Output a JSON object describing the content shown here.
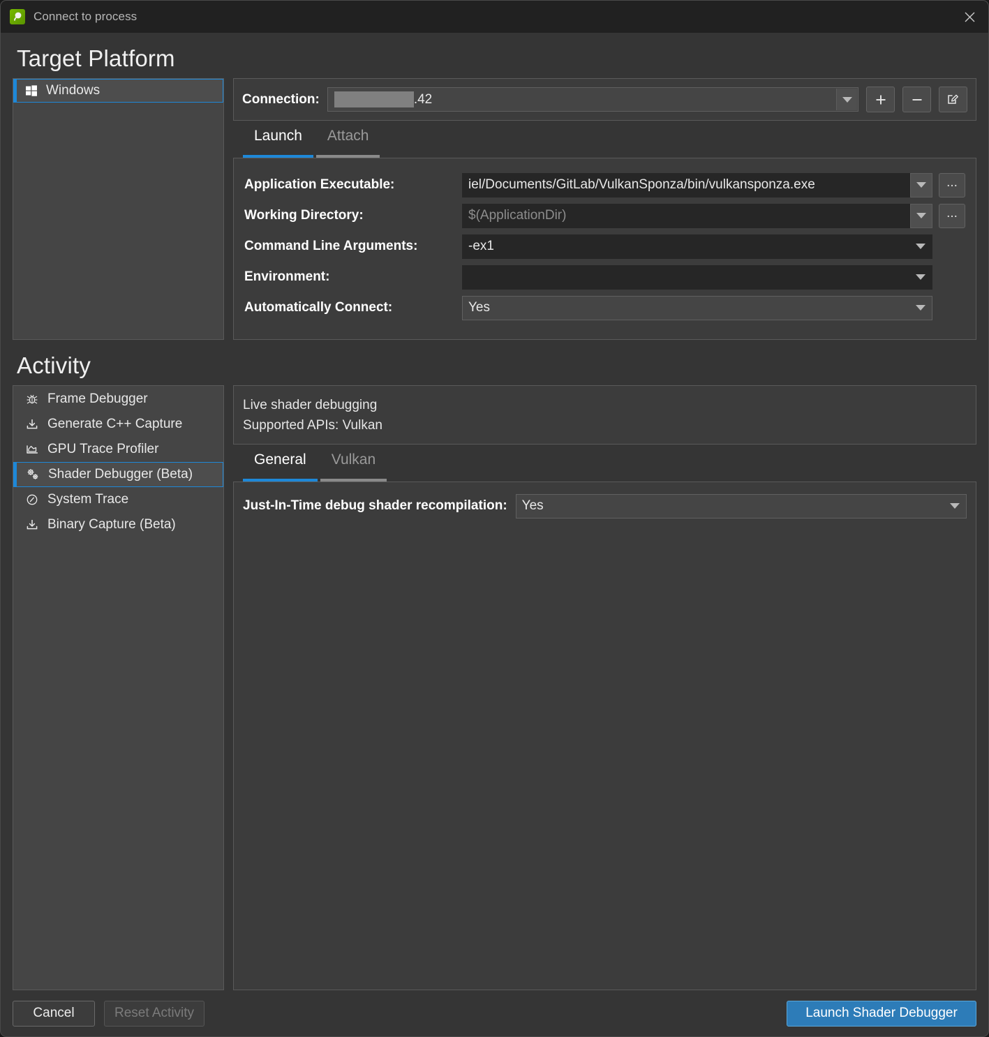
{
  "window": {
    "title": "Connect to process",
    "app_icon": "nsight-icon",
    "close_icon": "close-icon"
  },
  "target_platform": {
    "heading": "Target Platform",
    "platforms": [
      {
        "label": "Windows",
        "icon": "windows-icon",
        "selected": true
      }
    ],
    "connection": {
      "label": "Connection:",
      "value_redacted": true,
      "value_suffix": ".42",
      "add_icon": "plus-icon",
      "remove_icon": "minus-icon",
      "edit_icon": "edit-pencil-icon"
    },
    "tabs": [
      {
        "label": "Launch",
        "active": true
      },
      {
        "label": "Attach",
        "active": false
      }
    ],
    "fields": [
      {
        "label": "Application Executable:",
        "value": "iel/Documents/GitLab/VulkanSponza/bin/vulkansponza.exe",
        "placeholder": "",
        "has_dropdown": true,
        "has_browse": true,
        "browse_label": "...",
        "bordered": false
      },
      {
        "label": "Working Directory:",
        "value": "",
        "placeholder": "$(ApplicationDir)",
        "has_dropdown": true,
        "has_browse": true,
        "browse_label": "...",
        "bordered": false
      },
      {
        "label": "Command Line Arguments:",
        "value": "-ex1",
        "placeholder": "",
        "has_dropdown": true,
        "has_browse": false,
        "browse_label": "",
        "bordered": false
      },
      {
        "label": "Environment:",
        "value": "",
        "placeholder": "",
        "has_dropdown": true,
        "has_browse": false,
        "browse_label": "",
        "bordered": false
      },
      {
        "label": "Automatically Connect:",
        "value": "Yes",
        "placeholder": "",
        "has_dropdown": true,
        "has_browse": false,
        "browse_label": "",
        "bordered": true
      }
    ]
  },
  "activity": {
    "heading": "Activity",
    "items": [
      {
        "label": "Frame Debugger",
        "icon": "bug-icon",
        "selected": false
      },
      {
        "label": "Generate C++ Capture",
        "icon": "download-tray-icon",
        "selected": false
      },
      {
        "label": "GPU Trace Profiler",
        "icon": "chart-area-icon",
        "selected": false
      },
      {
        "label": "Shader Debugger (Beta)",
        "icon": "gears-icon",
        "selected": true
      },
      {
        "label": "System Trace",
        "icon": "gauge-clock-icon",
        "selected": false
      },
      {
        "label": "Binary Capture (Beta)",
        "icon": "download-tray-icon",
        "selected": false
      }
    ],
    "description": {
      "line1": "Live shader debugging",
      "line2": "Supported APIs: Vulkan"
    },
    "tabs": [
      {
        "label": "General",
        "active": true
      },
      {
        "label": "Vulkan",
        "active": false
      }
    ],
    "options": [
      {
        "label": "Just-In-Time debug shader recompilation:",
        "value": "Yes"
      }
    ]
  },
  "footer": {
    "cancel": "Cancel",
    "reset": "Reset Activity",
    "reset_disabled": true,
    "launch": "Launch Shader Debugger"
  },
  "colors": {
    "accent": "#1e88d8",
    "primary_button": "#2d7cb8",
    "panel": "#3c3c3c",
    "list": "#454545",
    "input": "#262626",
    "titlebar": "#212121",
    "brand_green": "#76b900"
  }
}
